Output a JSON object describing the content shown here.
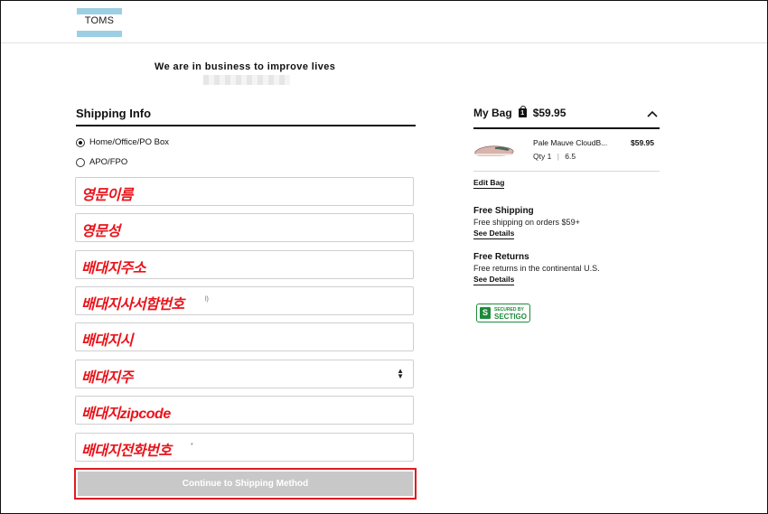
{
  "header": {
    "logo_text": "TOMS"
  },
  "tagline": "We are in business to improve lives",
  "shipping": {
    "title": "Shipping Info",
    "options": [
      {
        "label": "Home/Office/PO Box",
        "selected": true
      },
      {
        "label": "APO/FPO",
        "selected": false
      }
    ],
    "fields": [
      {
        "note": "영문이름"
      },
      {
        "note": "영문성"
      },
      {
        "note": "배대지주소"
      },
      {
        "note": "배대지사서함번호",
        "hint": "l)"
      },
      {
        "note": "배대지시"
      },
      {
        "note": "배대지주"
      },
      {
        "note": "배대지zipcode"
      },
      {
        "note": "배대지전화번호",
        "hint": "*"
      }
    ],
    "continue_label": "Continue to Shipping Method",
    "highlight_color": "#e01b22"
  },
  "bag": {
    "title": "My Bag",
    "count": "1",
    "total": "$59.95",
    "item": {
      "name": "Pale Mauve CloudB...",
      "qty": "Qty 1",
      "size": "6.5",
      "price": "$59.95"
    },
    "edit_label": "Edit Bag",
    "free_shipping": {
      "title": "Free Shipping",
      "text": "Free shipping on orders $59+",
      "link": "See Details"
    },
    "free_returns": {
      "title": "Free Returns",
      "text": "Free returns in the continental U.S.",
      "link": "See Details"
    },
    "badge": {
      "line1": "SECURED BY",
      "line2": "SECTIGO",
      "icon": "sectigo-logo"
    }
  }
}
